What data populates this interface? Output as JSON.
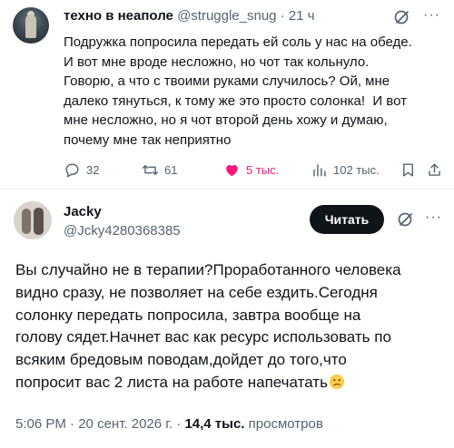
{
  "tweet1": {
    "author_name": "техно в неаполе",
    "handle": "@struggle_snug",
    "separator": "·",
    "time": "21 ч",
    "more": "···",
    "lines": [
      "Подружка попросила передать ей соль у нас на обеде.",
      "И вот мне вроде несложно, но чот так кольнуло.",
      "Говорю, а что с твоими руками случилось? Ой, мне",
      "далеко тянуться, к тому же это просто солонка!  И вот",
      "мне несложно, но я чот второй день хожу и думаю,",
      "почему мне так неприятно"
    ],
    "replies": "32",
    "retweets": "61",
    "likes": "5 тыс.",
    "views": "102 тыс."
  },
  "tweet2": {
    "author_name": "Jacky",
    "handle": "@Jcky4280368385",
    "read_button": "Читать",
    "more": "···",
    "lines": [
      "Вы случайно не в терапии?Проработанного человека",
      "видно сразу, не позволяет на себе ездить.Сегодня",
      "солонку передать попросила, завтра вообще на",
      "голову сядет.Начнет вас как ресурс использовать по",
      "всяким бредовым поводам,дойдет до того,что",
      "попросит вас 2 листа на работе напечатать"
    ],
    "time": "5:06 PM",
    "dot": "·",
    "date": "20 сент. 2026 г.",
    "views_count": "14,4 тыс.",
    "views_label": "просмотров"
  },
  "colors": {
    "text": "#0f1419",
    "secondary": "#536471",
    "like": "#f91880",
    "button_bg": "#0f1419",
    "divider": "#eff3f4"
  },
  "icons": [
    "grok-icon",
    "more-icon",
    "reply-icon",
    "retweet-icon",
    "like-icon",
    "views-icon",
    "bookmark-icon",
    "share-icon",
    "confused-emoji"
  ]
}
